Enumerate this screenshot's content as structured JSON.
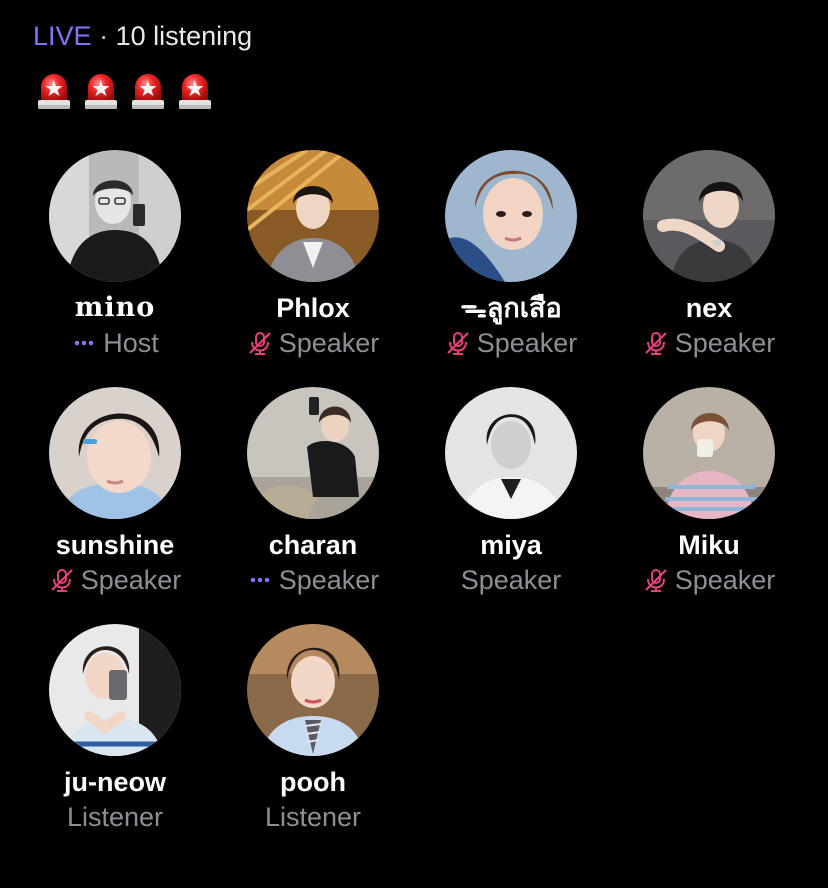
{
  "header": {
    "live_label": "LIVE",
    "separator": "·",
    "listening_text": "10 listening",
    "live_color": "#8b6ff7"
  },
  "emoji_row": [
    "siren-icon",
    "siren-icon",
    "siren-icon",
    "siren-icon"
  ],
  "participants": [
    {
      "name": "𝐦𝐢𝐧𝐨",
      "role": "Host",
      "status_icon": "more-dots-icon"
    },
    {
      "name": "Phlox",
      "role": "Speaker",
      "status_icon": "muted-mic-icon"
    },
    {
      "name": "ᯓลูกเสือ",
      "role": "Speaker",
      "status_icon": "muted-mic-icon"
    },
    {
      "name": "nex",
      "role": "Speaker",
      "status_icon": "muted-mic-icon"
    },
    {
      "name": "sunshine",
      "role": "Speaker",
      "status_icon": "muted-mic-icon"
    },
    {
      "name": "charan",
      "role": "Speaker",
      "status_icon": "more-dots-icon"
    },
    {
      "name": "miya",
      "role": "Speaker",
      "status_icon": null
    },
    {
      "name": "Miku",
      "role": "Speaker",
      "status_icon": "muted-mic-icon"
    },
    {
      "name": "ju-neow",
      "role": "Listener",
      "status_icon": null
    },
    {
      "name": "pooh",
      "role": "Listener",
      "status_icon": null
    }
  ],
  "colors": {
    "muted_icon": "#e83e7b",
    "dots_icon": "#8b6ff7",
    "role_text": "#8e8e96"
  }
}
